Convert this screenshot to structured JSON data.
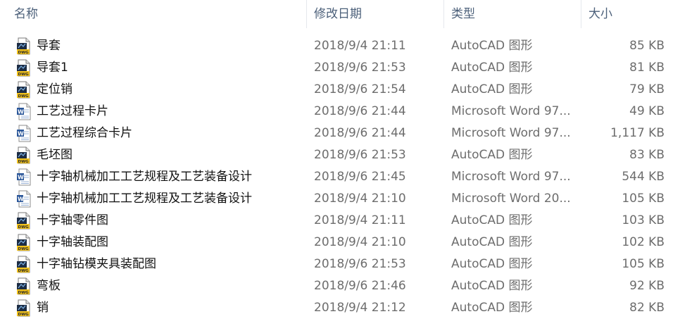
{
  "columns": {
    "name": "名称",
    "date": "修改日期",
    "type": "类型",
    "size": "大小"
  },
  "rows": [
    {
      "name": "导套",
      "date": "2018/9/4 21:11",
      "type": "AutoCAD 图形",
      "size": "85 KB",
      "icon": "dwg-file-icon"
    },
    {
      "name": "导套1",
      "date": "2018/9/6 21:53",
      "type": "AutoCAD 图形",
      "size": "81 KB",
      "icon": "dwg-file-icon"
    },
    {
      "name": "定位销",
      "date": "2018/9/6 21:54",
      "type": "AutoCAD 图形",
      "size": "79 KB",
      "icon": "dwg-file-icon"
    },
    {
      "name": "工艺过程卡片",
      "date": "2018/9/6 21:44",
      "type": "Microsoft Word 97...",
      "size": "49 KB",
      "icon": "word-doc-icon"
    },
    {
      "name": "工艺过程综合卡片",
      "date": "2018/9/6 21:44",
      "type": "Microsoft Word 97...",
      "size": "1,117 KB",
      "icon": "word-doc-icon"
    },
    {
      "name": "毛坯图",
      "date": "2018/9/6 21:53",
      "type": "AutoCAD 图形",
      "size": "83 KB",
      "icon": "dwg-file-icon"
    },
    {
      "name": "十字轴机械加工工艺规程及工艺装备设计",
      "date": "2018/9/6 21:45",
      "type": "Microsoft Word 97...",
      "size": "544 KB",
      "icon": "word-doc-icon"
    },
    {
      "name": "十字轴机械加工工艺规程及工艺装备设计",
      "date": "2018/9/4 21:10",
      "type": "Microsoft Word 20...",
      "size": "105 KB",
      "icon": "word-docx-icon"
    },
    {
      "name": "十字轴零件图",
      "date": "2018/9/4 21:11",
      "type": "AutoCAD 图形",
      "size": "103 KB",
      "icon": "dwg-file-icon"
    },
    {
      "name": "十字轴装配图",
      "date": "2018/9/4 21:10",
      "type": "AutoCAD 图形",
      "size": "102 KB",
      "icon": "dwg-file-icon"
    },
    {
      "name": "十字轴钻模夹具装配图",
      "date": "2018/9/6 21:53",
      "type": "AutoCAD 图形",
      "size": "105 KB",
      "icon": "dwg-file-icon"
    },
    {
      "name": "弯板",
      "date": "2018/9/6 21:46",
      "type": "AutoCAD 图形",
      "size": "92 KB",
      "icon": "dwg-file-icon"
    },
    {
      "name": "销",
      "date": "2018/9/4 21:12",
      "type": "AutoCAD 图形",
      "size": "82 KB",
      "icon": "dwg-file-icon"
    }
  ],
  "icons": {
    "dwg_label": "DWG",
    "word_label": "W"
  },
  "colors": {
    "header_text": "#4c607a",
    "name_text": "#111111",
    "meta_text": "#6d6d6d",
    "dwg_yellow": "#f2c21b",
    "dwg_dark": "#2b2b2b",
    "word_blue": "#2a5699"
  }
}
